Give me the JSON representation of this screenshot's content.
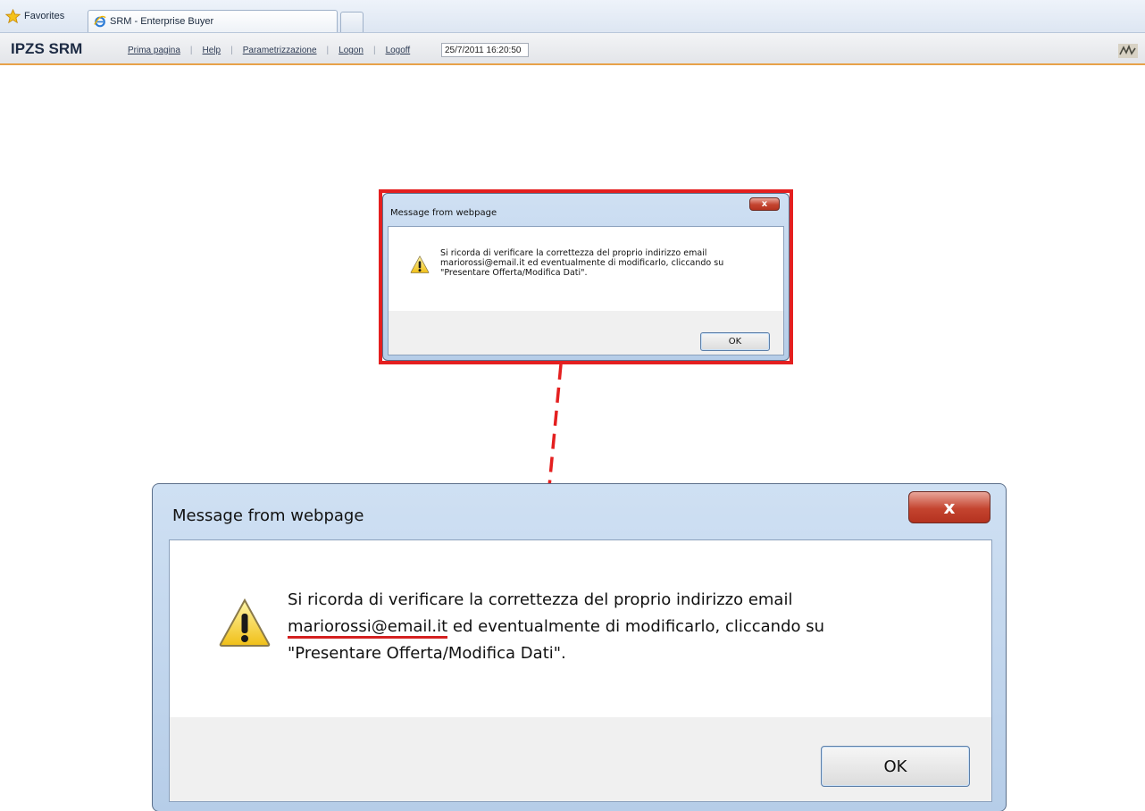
{
  "browser": {
    "favorites_label": "Favorites",
    "tab_title": "SRM - Enterprise Buyer"
  },
  "app": {
    "brand": "IPZS SRM",
    "nav": [
      {
        "label": "Prima pagina"
      },
      {
        "label": "Help"
      },
      {
        "label": "Parametrizzazione"
      },
      {
        "label": "Logon"
      },
      {
        "label": "Logoff"
      }
    ],
    "datetime": "25/7/2011 16:20:50"
  },
  "dialog": {
    "title": "Message from webpage",
    "close_glyph": "x",
    "message_line1": "Si ricorda di verificare la correttezza del proprio indirizzo email",
    "email": "mariorossi@email.it",
    "message_line2_rest": " ed eventualmente di modificarlo, cliccando su",
    "message_line3": "\"Presentare Offerta/Modifica Dati\".",
    "ok_label": "OK",
    "icon": "warning-icon"
  },
  "colors": {
    "highlight": "#e41f1f",
    "arrow": "#e41f1f",
    "header_accent": "#e8a24a"
  }
}
